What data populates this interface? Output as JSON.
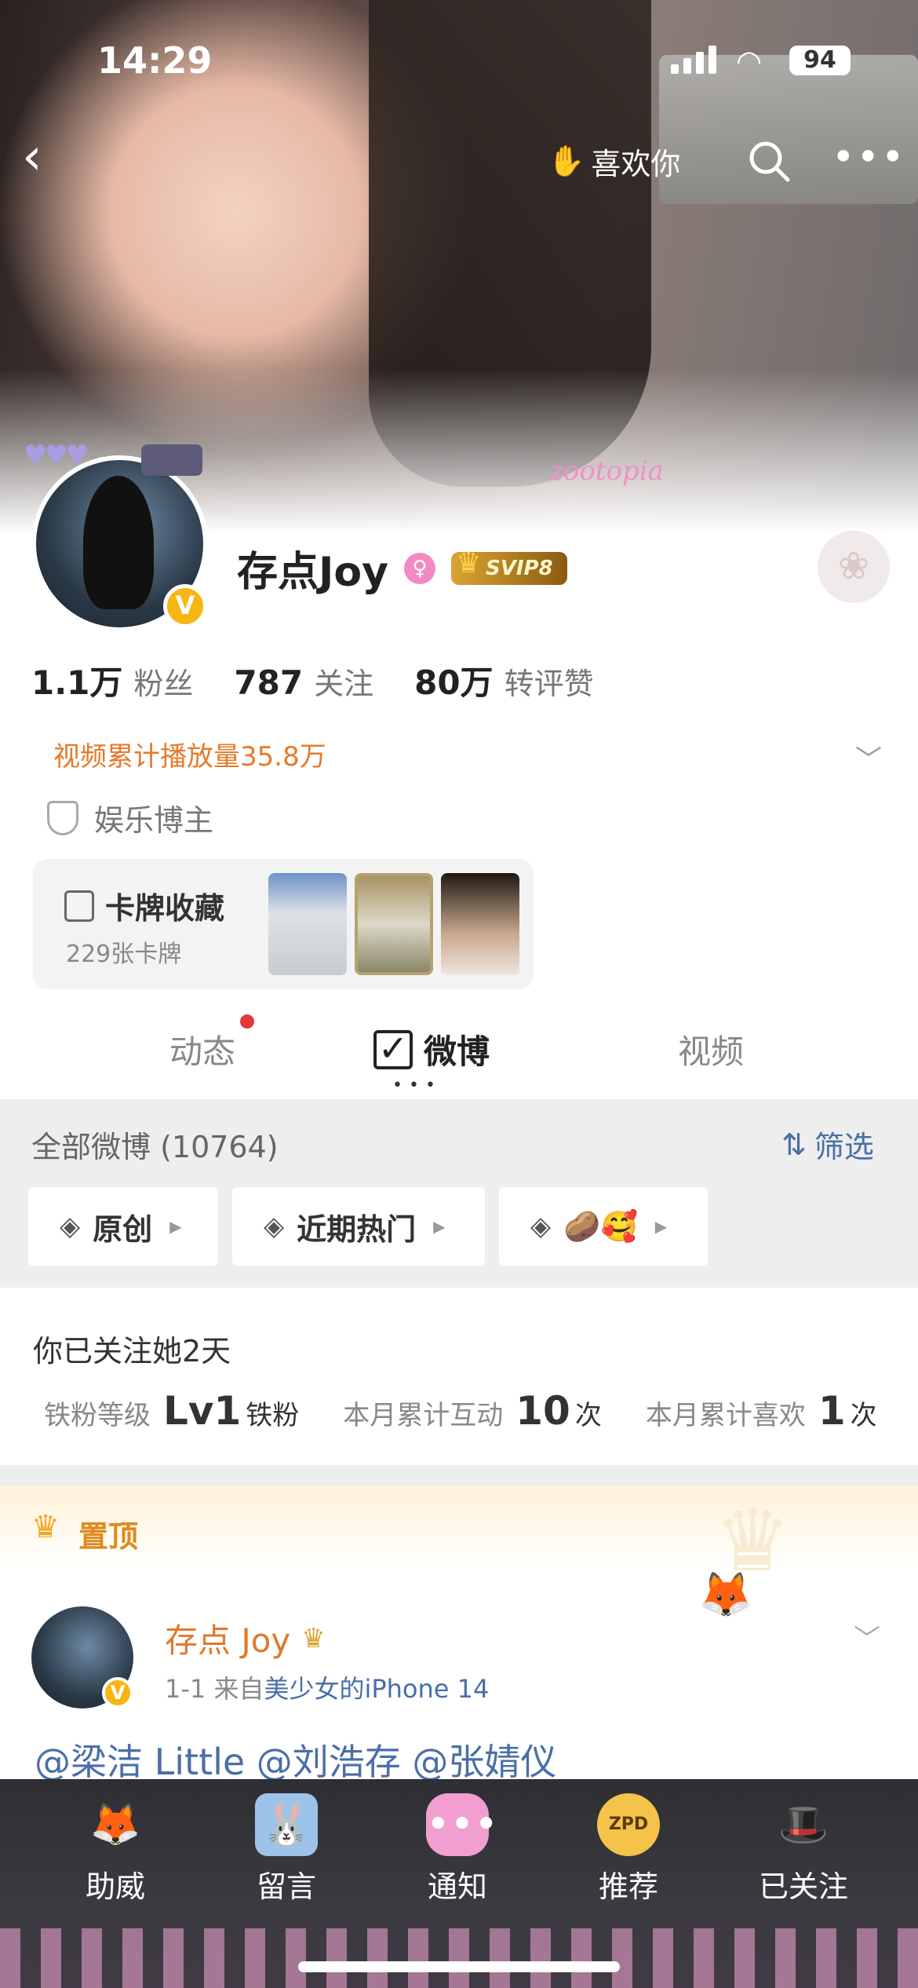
{
  "status_bar": {
    "time": "14:29",
    "battery": "94"
  },
  "nav": {
    "back_icon": "back-chevron-icon",
    "like_you": "喜欢你"
  },
  "profile": {
    "name": "存点Joy",
    "vip_badge": "SVIP8",
    "stats": [
      {
        "value": "1.1万",
        "label": "粉丝"
      },
      {
        "value": "787",
        "label": "关注"
      },
      {
        "value": "80万",
        "label": "转评赞"
      }
    ],
    "video_plays": "视频累计播放量35.8万",
    "tag": "娱乐博主",
    "cover_decoration": "zootopia"
  },
  "card_collection": {
    "title": "卡牌收藏",
    "count": "229张卡牌"
  },
  "tabs": {
    "dynamic": "动态",
    "weibo": "微博",
    "video": "视频"
  },
  "filter": {
    "all_count": "全部微博 (10764)",
    "sift": "筛选",
    "chips": [
      {
        "label": "原创"
      },
      {
        "label": "近期热门"
      },
      {
        "label": "🥔🥰"
      }
    ]
  },
  "fan_info": {
    "follow_days": "你已关注她2天",
    "level_label": "铁粉等级",
    "level_value": "Lv1",
    "level_suffix": "铁粉",
    "interact_label": "本月累计互动",
    "interact_value": "10",
    "interact_unit": "次",
    "like_label": "本月累计喜欢",
    "like_value": "1",
    "like_unit": "次"
  },
  "pinned": {
    "label": "置顶"
  },
  "post": {
    "author": "存点 Joy",
    "date": "1-1",
    "from": "来自",
    "source": "美少女的iPhone 14",
    "text": "@梁洁 Little @刘浩存 @张婧仪"
  },
  "tabbar": [
    {
      "label": "助威",
      "icon": "fox-icon"
    },
    {
      "label": "留言",
      "icon": "rabbit-icon"
    },
    {
      "label": "通知",
      "icon": "chat-bubble-icon"
    },
    {
      "label": "推荐",
      "icon": "zpd-badge-icon",
      "badge_text": "ZPD"
    },
    {
      "label": "已关注",
      "icon": "hat-icon"
    }
  ],
  "colors": {
    "accent_orange": "#e57a2a",
    "link_blue": "#4a6ea8",
    "svip_gold": "#d8a531",
    "pink": "#f28ac1"
  }
}
